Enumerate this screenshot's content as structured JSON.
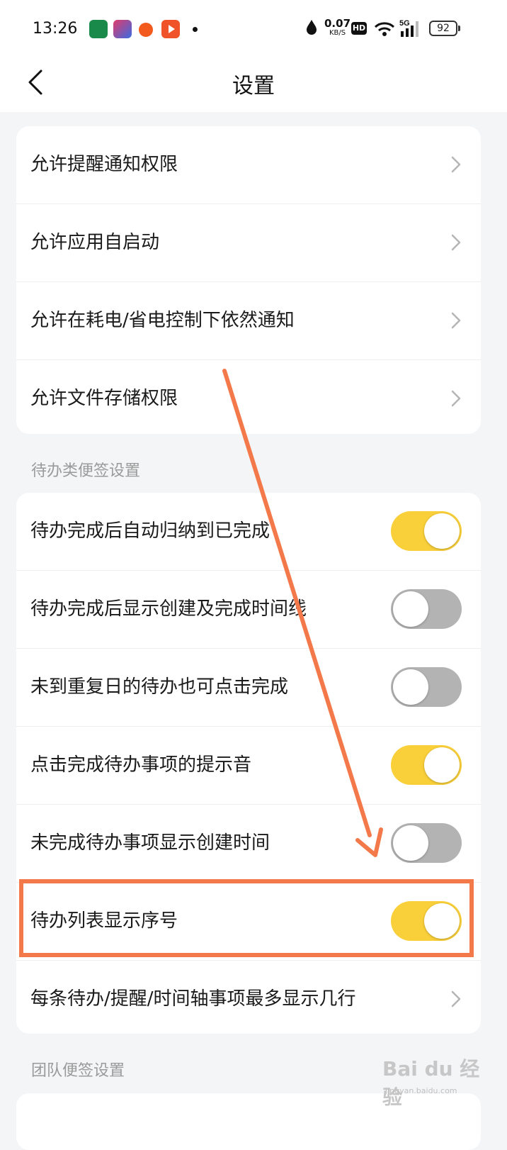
{
  "status_bar": {
    "time": "13:26",
    "net_speed": "0.07",
    "net_unit": "KB/S",
    "hd": "HD",
    "signal_label": "5G",
    "battery": "92"
  },
  "header": {
    "title": "设置"
  },
  "permissions": {
    "items": [
      {
        "label": "允许提醒通知权限"
      },
      {
        "label": "允许应用自启动"
      },
      {
        "label": "允许在耗电/省电控制下依然通知"
      },
      {
        "label": "允许文件存储权限"
      }
    ]
  },
  "todo_section": {
    "header": "待办类便签设置",
    "items": [
      {
        "label": "待办完成后自动归纳到已完成",
        "toggle": "on"
      },
      {
        "label": "待办完成后显示创建及完成时间线",
        "toggle": "off"
      },
      {
        "label": "未到重复日的待办也可点击完成",
        "toggle": "off"
      },
      {
        "label": "点击完成待办事项的提示音",
        "toggle": "on"
      },
      {
        "label": "未完成待办事项显示创建时间",
        "toggle": "off"
      },
      {
        "label": "待办列表显示序号",
        "toggle": "on"
      },
      {
        "label": "每条待办/提醒/时间轴事项最多显示几行"
      }
    ]
  },
  "team_section": {
    "header": "团队便签设置"
  },
  "colors": {
    "toggle_on": "#f9cf3a",
    "toggle_off": "#b3b3b3",
    "annotation": "#f4794a"
  },
  "watermark": {
    "brand": "Bai du 经验",
    "url": "jingyan.baidu.com"
  }
}
